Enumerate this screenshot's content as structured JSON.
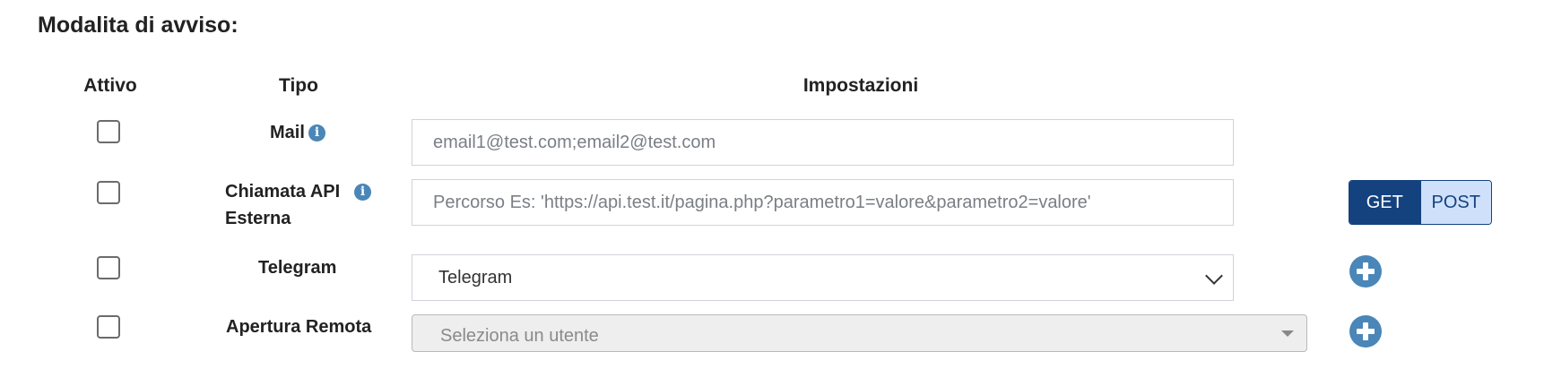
{
  "section": {
    "title": "Modalita di avviso:"
  },
  "columns": {
    "active": "Attivo",
    "type": "Tipo",
    "settings": "Impostazioni"
  },
  "rows": {
    "mail": {
      "label": "Mail",
      "placeholder": "email1@test.com;email2@test.com",
      "info_icon": "info-icon"
    },
    "api": {
      "label_line1": "Chiamata API",
      "label_line2": "Esterna",
      "placeholder": "Percorso Es: 'https://api.test.it/pagina.php?parametro1=valore&parametro2=valore'",
      "methods": {
        "get": "GET",
        "post": "POST"
      },
      "selected_method": "GET"
    },
    "telegram": {
      "label": "Telegram",
      "selected": "Telegram"
    },
    "remote": {
      "label": "Apertura Remota",
      "placeholder": "Seleziona un utente"
    }
  },
  "colors": {
    "accent": "#14427f",
    "info": "#4a86b8",
    "post_bg": "#cfe0fa"
  }
}
